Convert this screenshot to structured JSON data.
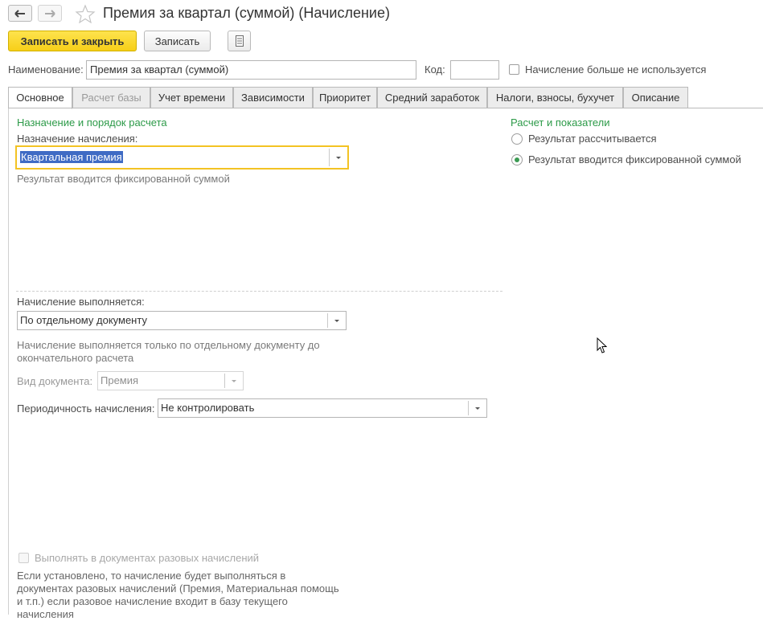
{
  "window": {
    "title": "Премия за квартал (суммой) (Начисление)"
  },
  "toolbar": {
    "save_close_label": "Записать и закрыть",
    "save_label": "Записать"
  },
  "header": {
    "name_label": "Наименование:",
    "name_value": "Премия за квартал (суммой)",
    "code_label": "Код:",
    "code_value": "",
    "unused_label": "Начисление больше не используется"
  },
  "tabs": [
    {
      "label": "Основное"
    },
    {
      "label": "Расчет базы"
    },
    {
      "label": "Учет времени"
    },
    {
      "label": "Зависимости"
    },
    {
      "label": "Приоритет"
    },
    {
      "label": "Средний заработок"
    },
    {
      "label": "Налоги, взносы, бухучет"
    },
    {
      "label": "Описание"
    }
  ],
  "main": {
    "section_left": "Назначение и порядок расчета",
    "purpose_label": "Назначение начисления:",
    "purpose_value": "Квартальная премия",
    "purpose_hint": "Результат вводится фиксированной суммой",
    "execution_label": "Начисление выполняется:",
    "execution_value": "По отдельному документу",
    "execution_hint_1": "Начисление выполняется только по отдельному документу до",
    "execution_hint_2": "окончательного расчета",
    "doc_type_label": "Вид документа:",
    "doc_type_value": "Премия",
    "periodicity_label": "Периодичность начисления:",
    "periodicity_value": "Не контролировать",
    "one_time_label": "Выполнять в документах разовых начислений",
    "note_1": "Если установлено, то начисление будет выполняться в",
    "note_2": "документах разовых начислений (Премия, Материальная помощь",
    "note_3": "и т.п.) если разовое начисление входит в базу текущего",
    "note_4": "начисления"
  },
  "right": {
    "section": "Расчет и показатели",
    "radio_calc": "Результат рассчитывается",
    "radio_fixed": "Результат вводится фиксированной суммой"
  },
  "colors": {
    "accent_yellow": "#fbd831",
    "section_green": "#2c9a48",
    "focus_border": "#f3c323",
    "selection": "#3f6bc4"
  }
}
